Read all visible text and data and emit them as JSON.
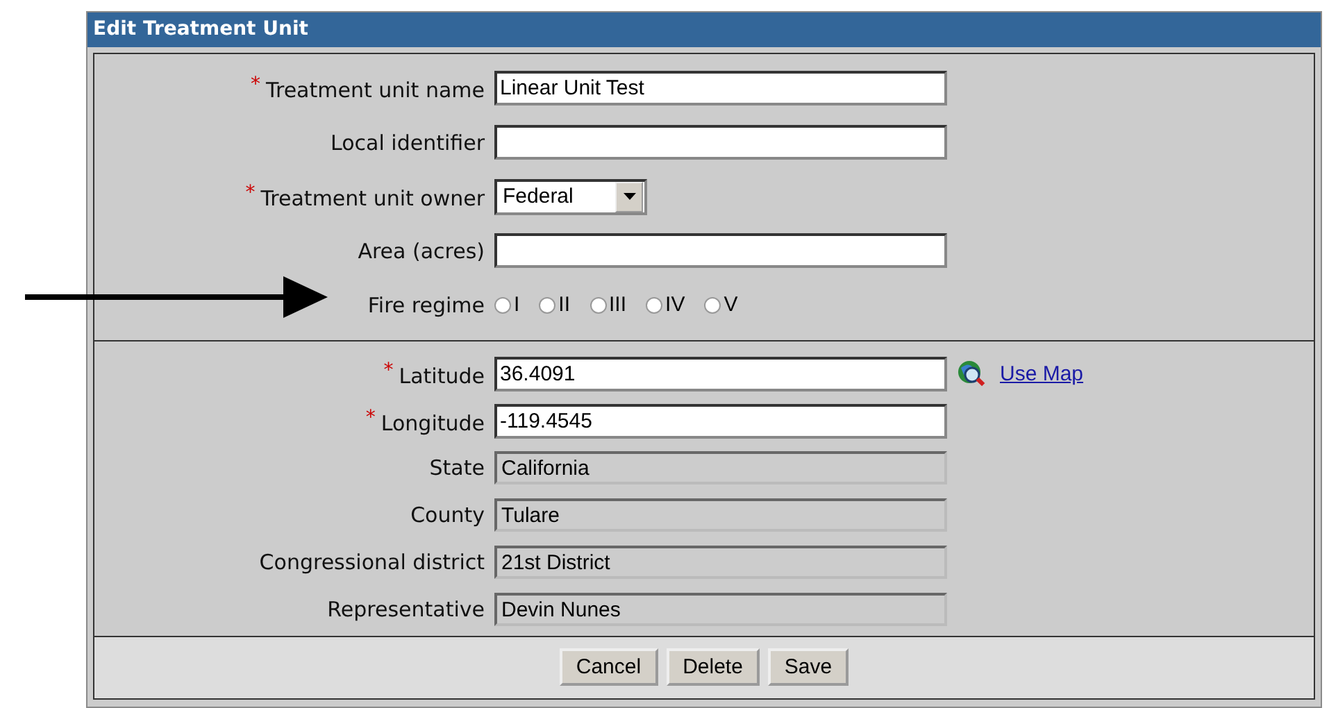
{
  "window": {
    "title": "Edit Treatment Unit"
  },
  "sections": [
    {
      "fields": [
        {
          "kind": "text",
          "label": "Treatment unit name",
          "marker": "*",
          "value": "Linear Unit Test"
        },
        {
          "kind": "text",
          "label": "Local identifier"
        },
        {
          "kind": "select",
          "label": "Treatment unit owner",
          "marker": "*",
          "value": "Federal"
        },
        {
          "kind": "text",
          "label": "Area (acres)"
        },
        {
          "kind": "radio",
          "label": "Fire regime",
          "options": [
            {
              "label": "I",
              "selected": false
            },
            {
              "label": "II",
              "selected": false
            },
            {
              "label": "III",
              "selected": false
            },
            {
              "label": "IV",
              "selected": false
            },
            {
              "label": "V",
              "selected": false
            }
          ]
        }
      ]
    },
    {
      "fields": [
        {
          "kind": "text",
          "label": "Latitude",
          "marker": "*",
          "value": "36.4091",
          "link": "Use Map"
        },
        {
          "kind": "text",
          "label": "Longitude",
          "marker": "*",
          "value": "-119.4545"
        },
        {
          "kind": "readonly",
          "label": "State",
          "value": "California"
        },
        {
          "kind": "readonly",
          "label": "County",
          "value": "Tulare"
        },
        {
          "kind": "readonly",
          "label": "Congressional district",
          "value": "21st District"
        },
        {
          "kind": "readonly",
          "label": "Representative",
          "value": "Devin Nunes"
        }
      ]
    }
  ],
  "buttons": [
    "Cancel",
    "Delete",
    "Save"
  ],
  "annotation": {
    "kind": "arrow"
  }
}
